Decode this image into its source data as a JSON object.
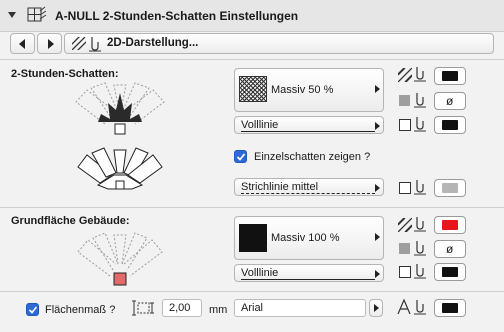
{
  "header": {
    "title": "A-NULL 2-Stunden-Schatten Einstellungen"
  },
  "nav": {
    "view": "2D-Darstellung..."
  },
  "shadow": {
    "section_label": "2-Stunden-Schatten:",
    "fill_name": "Massiv 50 %",
    "line_type": "Volllinie",
    "single_shadow_checkbox": "Einzelschatten zeigen ?",
    "single_line_type": "Strichlinie mittel",
    "pen_fg_color": "#111111",
    "pen_bg_symbol": "ø",
    "pen_contour_color": "#111111",
    "pen_single_color": "#b5b5b5"
  },
  "base": {
    "section_label": "Grundfläche Gebäude:",
    "fill_name": "Massiv 100 %",
    "line_type": "Volllinie",
    "pen_fg_color": "#e8151b",
    "pen_bg_symbol": "ø",
    "pen_contour_color": "#111111"
  },
  "area": {
    "checkbox_label": "Flächenmaß ?",
    "size_value": "2,00",
    "unit": "mm",
    "font": "Arial",
    "text_pen_color": "#111111"
  }
}
